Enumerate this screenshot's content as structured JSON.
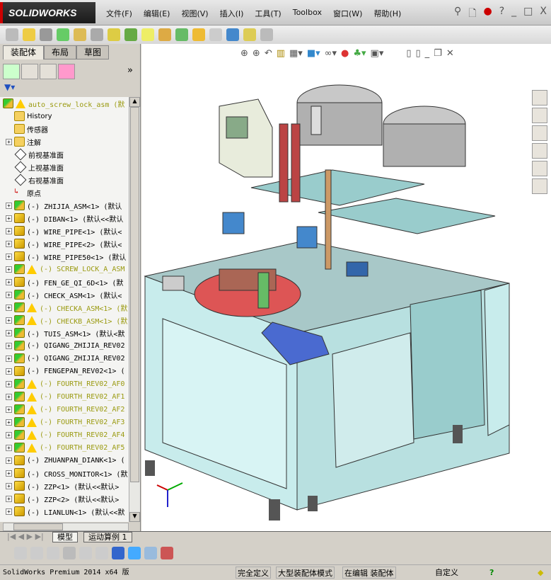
{
  "app": {
    "logo": "SOLIDWORKS",
    "menus": [
      "文件(F)",
      "编辑(E)",
      "视图(V)",
      "插入(I)",
      "工具(T)",
      "Toolbox",
      "窗口(W)",
      "帮助(H)"
    ],
    "window_buttons": [
      "?",
      "_",
      "□",
      "X"
    ]
  },
  "panel": {
    "tabs": [
      "装配体",
      "布局",
      "草图"
    ],
    "more": "»"
  },
  "tree": [
    {
      "text": "auto_screw_lock_asm  (默",
      "type": "asm",
      "warn": true,
      "exp": false,
      "root": true
    },
    {
      "text": "History",
      "type": "history",
      "exp": false
    },
    {
      "text": "传感器",
      "type": "sensor",
      "exp": false
    },
    {
      "text": "注解",
      "type": "annot",
      "exp": true
    },
    {
      "text": "前视基准面",
      "type": "plane",
      "exp": false
    },
    {
      "text": "上视基准面",
      "type": "plane",
      "exp": false
    },
    {
      "text": "右视基准面",
      "type": "plane",
      "exp": false
    },
    {
      "text": "原点",
      "type": "origin",
      "exp": false
    },
    {
      "text": "(-) ZHIJIA_ASM<1> (默认",
      "type": "asm",
      "exp": true
    },
    {
      "text": "(-) DIBAN<1> (默认<<默认",
      "type": "part",
      "exp": true
    },
    {
      "text": "(-) WIRE_PIPE<1> (默认<",
      "type": "part",
      "exp": true
    },
    {
      "text": "(-) WIRE_PIPE<2> (默认<",
      "type": "part",
      "exp": true
    },
    {
      "text": "(-) WIRE_PIPE50<1> (默认",
      "type": "part",
      "exp": true
    },
    {
      "text": "(-) SCREW_LOCK_A_ASM",
      "type": "asm",
      "warn": true,
      "exp": true
    },
    {
      "text": "(-) FEN_GE_QI_6D<1> (默",
      "type": "part",
      "exp": true
    },
    {
      "text": "(-) CHECK_ASM<1> (默认<",
      "type": "asm",
      "exp": true
    },
    {
      "text": "(-) CHECKA_ASM<1> (默",
      "type": "asm",
      "warn": true,
      "exp": true
    },
    {
      "text": "(-) CHECKB_ASM<1> (默",
      "type": "asm",
      "warn": true,
      "exp": true
    },
    {
      "text": "(-) TUIS_ASM<1> (默认<默",
      "type": "asm",
      "exp": true
    },
    {
      "text": "(-) QIGANG_ZHIJIA_REV02",
      "type": "asm",
      "exp": true
    },
    {
      "text": "(-) QIGANG_ZHIJIA_REV02",
      "type": "asm",
      "exp": true
    },
    {
      "text": "(-) FENGEPAN_REV02<1> (",
      "type": "part",
      "exp": true
    },
    {
      "text": "(-) FOURTH_REV02_AF0",
      "type": "asm",
      "warn": true,
      "exp": true
    },
    {
      "text": "(-) FOURTH_REV02_AF1",
      "type": "asm",
      "warn": true,
      "exp": true
    },
    {
      "text": "(-) FOURTH_REV02_AF2",
      "type": "asm",
      "warn": true,
      "exp": true
    },
    {
      "text": "(-) FOURTH_REV02_AF3",
      "type": "asm",
      "warn": true,
      "exp": true
    },
    {
      "text": "(-) FOURTH_REV02_AF4",
      "type": "asm",
      "warn": true,
      "exp": true
    },
    {
      "text": "(-) FOURTH_REV02_AF5",
      "type": "asm",
      "warn": true,
      "exp": true
    },
    {
      "text": "(-) ZHUANPAN_DIANK<1> (",
      "type": "part",
      "exp": true
    },
    {
      "text": "(-) CROSS_MONITOR<1> (默",
      "type": "part",
      "exp": true
    },
    {
      "text": "(-) ZZP<1> (默认<<默认>",
      "type": "part",
      "exp": true
    },
    {
      "text": "(-) ZZP<2> (默认<<默认>",
      "type": "part",
      "exp": true
    },
    {
      "text": "(-) LIANLUN<1> (默认<<默",
      "type": "part",
      "exp": true
    }
  ],
  "bottom_tabs": [
    "模型",
    "运动算例 1"
  ],
  "status": {
    "product": "SolidWorks Premium 2014 x64 版",
    "state": "完全定义",
    "mode": "大型装配体模式",
    "editing": "在编辑 装配体",
    "units": "自定义",
    "help": "?"
  },
  "colors": {
    "cabinet": "#c8ecec",
    "frame": "#7aa8a8",
    "accent": "#3a5fc0",
    "warning": "#9a9a10"
  }
}
